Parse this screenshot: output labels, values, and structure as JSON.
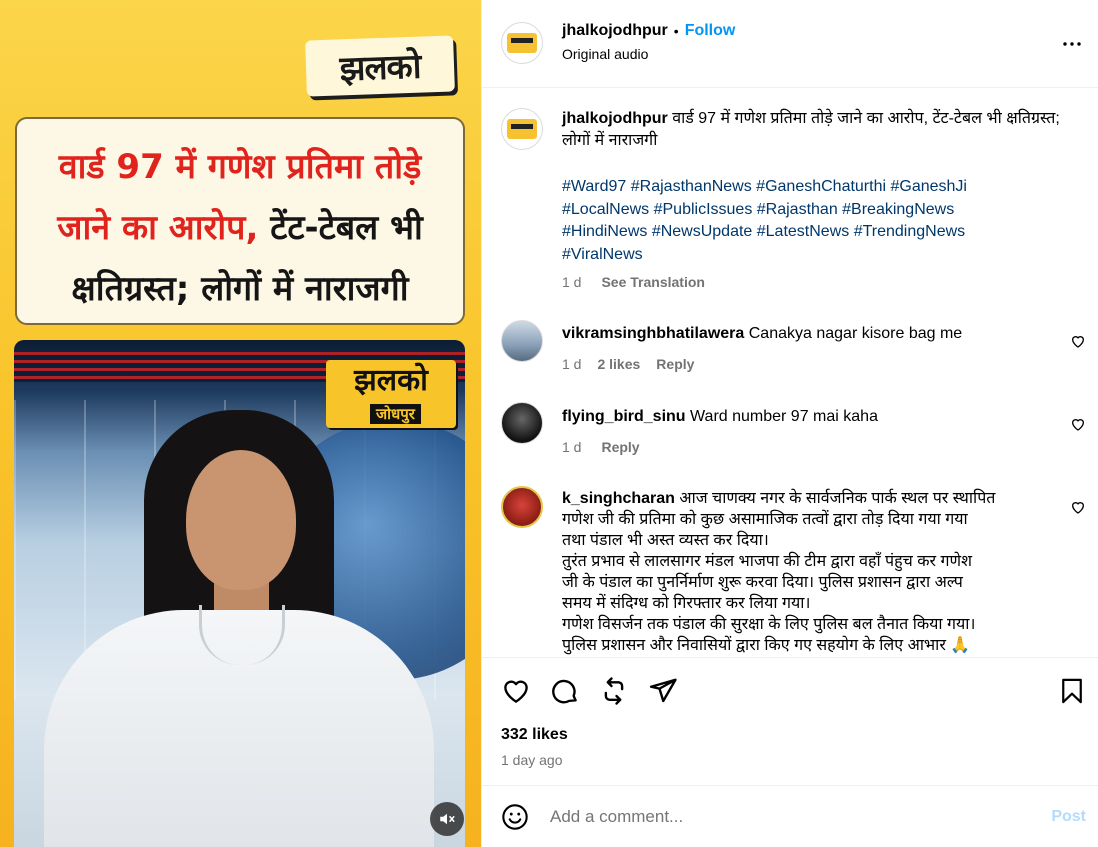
{
  "media": {
    "brand_logo": "झलको",
    "headline_line1": "वार्ड 97 में गणेश प्रतिमा तोड़े",
    "headline_line2_red": "जाने का आरोप,",
    "headline_line2_dark": " टेंट-टेबल भी",
    "headline_line3": "क्षतिग्रस्त; लोगों में नाराजगी",
    "video_logo_top": "झलको",
    "video_logo_bottom": "जोधपुर",
    "colors": {
      "background": "#f9c52c",
      "headline_red": "#e0241d"
    }
  },
  "header": {
    "username": "jhalkojodhpur",
    "separator": "•",
    "follow_label": "Follow",
    "audio": "Original audio",
    "more_icon": "more-horizontal-icon"
  },
  "caption": {
    "username": "jhalkojodhpur",
    "text": "वार्ड 97 में गणेश प्रतिमा तोड़े जाने का आरोप, टेंट-टेबल भी क्षतिग्रस्त; लोगों में नाराजगी",
    "hashtags_line1": "#Ward97 #RajasthanNews #GaneshChaturthi #GaneshJi",
    "hashtags_line2": "#LocalNews #PublicIssues #Rajasthan #BreakingNews",
    "hashtags_line3": "#HindiNews #NewsUpdate #LatestNews #TrendingNews",
    "hashtags_line4": "#ViralNews",
    "time": "1 d",
    "see_translation": "See Translation"
  },
  "comments": [
    {
      "username": "vikramsinghbhatilawera",
      "text": "Canakya nagar kisore bag me",
      "time": "1 d",
      "likes": "2 likes",
      "reply": "Reply"
    },
    {
      "username": "flying_bird_sinu",
      "text": "Ward number 97 mai kaha",
      "time": "1 d",
      "reply": "Reply"
    },
    {
      "username": "k_singhcharan",
      "line1": "आज चाणक्य नगर के सार्वजनिक पार्क स्थल पर स्थापित",
      "line2": "गणेश जी की प्रतिमा को कुछ असामाजिक तत्वों द्वारा तोड़ दिया गया गया",
      "line3": "तथा पंडाल भी अस्त व्यस्त कर दिया।",
      "line4": "तुरंत प्रभाव से लालसागर मंडल भाजपा की टीम द्वारा वहाँ पंहुच कर गणेश",
      "line5": "जी के पंडाल का पुनर्निर्माण शुरू करवा दिया। पुलिस प्रशासन द्वारा अल्प",
      "line6": "समय में संदिग्ध को गिरफ्तार कर लिया गया।",
      "line7": "गणेश विसर्जन तक पंडाल की सुरक्षा के लिए पुलिस बल तैनात किया गया।",
      "line8": "पुलिस प्रशासन और निवासियों द्वारा किए गए सहयोग के लिए आभार 🙏"
    }
  ],
  "actions": {
    "likes": "332 likes",
    "time": "1 day ago"
  },
  "comment_box": {
    "placeholder": "Add a comment...",
    "post_label": "Post"
  }
}
